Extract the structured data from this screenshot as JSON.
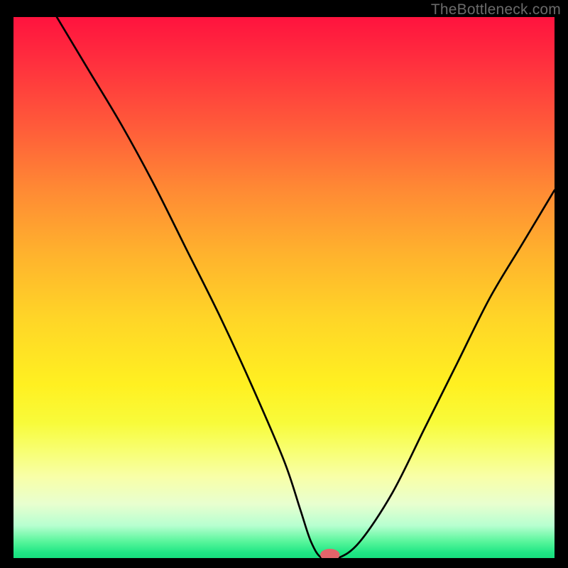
{
  "watermark": "TheBottleneck.com",
  "chart_data": {
    "type": "line",
    "title": "",
    "xlabel": "",
    "ylabel": "",
    "xlim": [
      0,
      100
    ],
    "ylim": [
      0,
      100
    ],
    "grid": false,
    "series": [
      {
        "name": "bottleneck-curve",
        "x": [
          8,
          14,
          20,
          26,
          32,
          38,
          44,
          50,
          53,
          55,
          57,
          60,
          64,
          70,
          76,
          82,
          88,
          94,
          100
        ],
        "y": [
          100,
          90,
          80,
          69,
          57,
          45,
          32,
          18,
          9,
          3,
          0,
          0,
          3,
          12,
          24,
          36,
          48,
          58,
          68
        ]
      }
    ],
    "marker": {
      "name": "optimal-point",
      "x": 58.5,
      "y": 0,
      "rx": 1.8,
      "ry": 1.1,
      "color": "#e4646a"
    },
    "gradient_stops": [
      {
        "pos": 0.0,
        "color": "#ff133e"
      },
      {
        "pos": 0.5,
        "color": "#ffd627"
      },
      {
        "pos": 0.8,
        "color": "#f8ff70"
      },
      {
        "pos": 1.0,
        "color": "#18e07e"
      }
    ]
  }
}
